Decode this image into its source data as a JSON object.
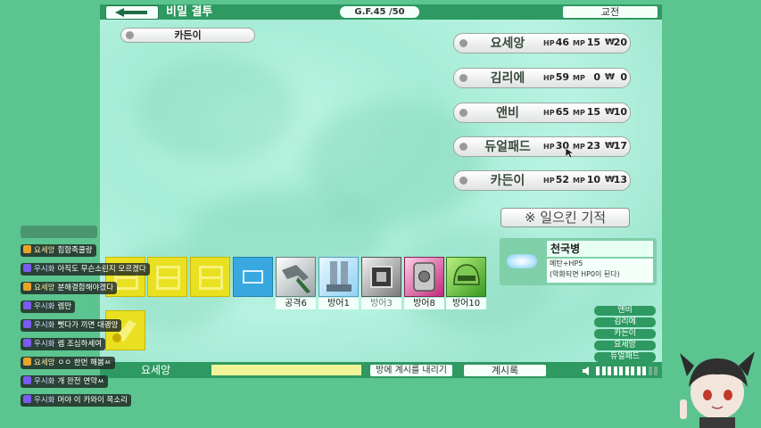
{
  "header": {
    "title": "비밀 결투",
    "gf_label": "G.F.45 /50",
    "exchange_label": "교전"
  },
  "target": {
    "name": "카든이"
  },
  "players": [
    {
      "name": "요세앙",
      "hp": "46",
      "mp": "15",
      "money": "20"
    },
    {
      "name": "김리에",
      "hp": "59",
      "mp": "0",
      "money": "0"
    },
    {
      "name": "앤비",
      "hp": "65",
      "mp": "15",
      "money": "10"
    },
    {
      "name": "듀얼패드",
      "hp": "30",
      "mp": "23",
      "money": "17"
    },
    {
      "name": "카든이",
      "hp": "52",
      "mp": "10",
      "money": "13"
    }
  ],
  "stat_labels": {
    "hp": "HP",
    "mp": "MP",
    "money": "₩"
  },
  "miracle_button": "※ 일으킨 기적",
  "card": {
    "name": "천국병",
    "desc_line1": "메탄+HP5",
    "desc_line2": "(악화되면 HP0이 된다)"
  },
  "equipment": [
    {
      "label": "공격6"
    },
    {
      "label": "방어1"
    },
    {
      "label": "방어3"
    },
    {
      "label": "방어8"
    },
    {
      "label": "방어10"
    }
  ],
  "bottom": {
    "player_name": "요세앙",
    "post_label": "방에 계시를 내리기",
    "board_label": "계시록"
  },
  "right_list": [
    "앤비",
    "김리에",
    "카든이",
    "요세앙",
    "듀얼패드"
  ],
  "volume": {
    "level": 0.85
  },
  "chat": [
    {
      "icon": "star",
      "user": "요세앙",
      "text": "힙합족쿨랑"
    },
    {
      "icon": "heart",
      "user": "우시화",
      "text": "아직도 무슨소린지 모르겠다"
    },
    {
      "icon": "star",
      "user": "요세앙",
      "text": "분해결합해야겠다"
    },
    {
      "icon": "heart",
      "user": "우시화",
      "text": "렘만"
    },
    {
      "icon": "heart",
      "user": "우시화",
      "text": "뻿다가 끼면 대괭앙"
    },
    {
      "icon": "heart",
      "user": "우시화",
      "text": "렘 조심하세여"
    },
    {
      "icon": "star",
      "user": "요세앙",
      "text": "ㅇㅇ 한번 해봄ㅆ"
    },
    {
      "icon": "heart",
      "user": "우시화",
      "text": "개 완전 연약ㅆ"
    },
    {
      "icon": "heart",
      "user": "우시화",
      "text": "머야 이 카와이 목소리"
    }
  ],
  "colors": {
    "bar": "#2e9a62",
    "background": "#5cc48e",
    "hand_yellow": "#e8e020"
  }
}
